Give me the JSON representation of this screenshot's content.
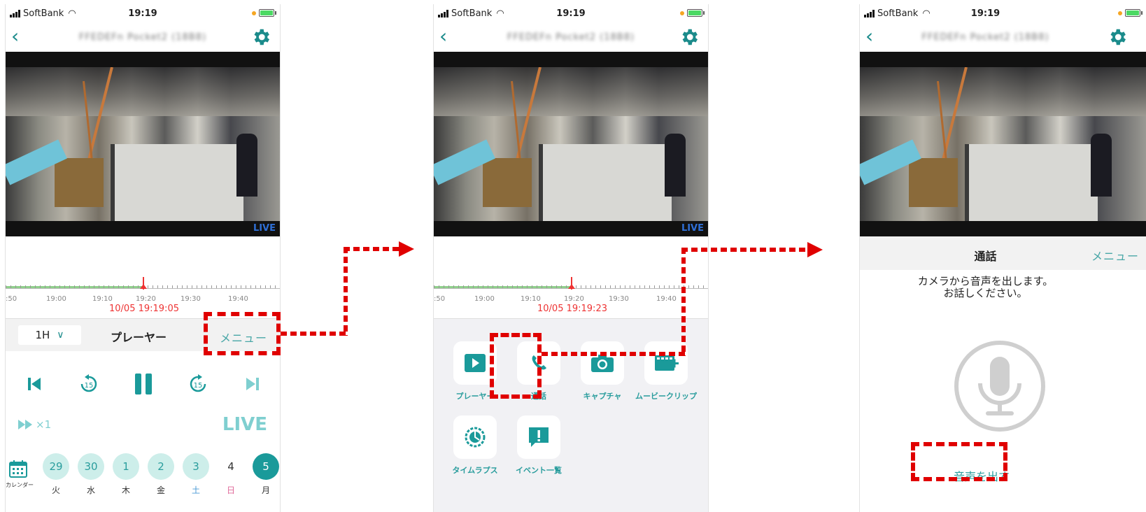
{
  "status_bar": {
    "carrier": "SoftBank",
    "time": "19:19"
  },
  "nav": {
    "title": "FFEDEFn Pocket2 (18B8)"
  },
  "video": {
    "live_badge": "LIVE"
  },
  "screen1": {
    "timeline": {
      "labels": [
        ":50",
        "19:00",
        "19:10",
        "19:20",
        "19:30",
        "19:40"
      ],
      "current_datetime": "10/05 19:19:05"
    },
    "controlbar": {
      "range": "1H",
      "title": "プレーヤー",
      "menu": "メニュー"
    },
    "speed": "×1",
    "live_button": "LIVE",
    "calendar_label": "カレンダー",
    "days": [
      {
        "num": "29",
        "week": "火"
      },
      {
        "num": "30",
        "week": "水"
      },
      {
        "num": "1",
        "week": "木"
      },
      {
        "num": "2",
        "week": "金"
      },
      {
        "num": "3",
        "week": "土"
      },
      {
        "num": "4",
        "week": "日"
      },
      {
        "num": "5",
        "week": "月"
      }
    ]
  },
  "screen2": {
    "timeline": {
      "labels": [
        ":50",
        "19:00",
        "19:10",
        "19:20",
        "19:30",
        "19:40"
      ],
      "current_datetime": "10/05 19:19:23"
    },
    "menu_items": [
      {
        "label": "プレーヤー",
        "icon": "play-icon"
      },
      {
        "label": "通話",
        "icon": "phone-icon"
      },
      {
        "label": "キャプチャ",
        "icon": "camera-icon"
      },
      {
        "label": "ムービークリップ",
        "icon": "movie-clip-icon"
      },
      {
        "label": "タイムラプス",
        "icon": "timelapse-icon"
      },
      {
        "label": "イベント一覧",
        "icon": "event-list-icon"
      }
    ]
  },
  "screen3": {
    "header_title": "通話",
    "menu": "メニュー",
    "message_line1": "カメラから音声を出します。",
    "message_line2": "お話しください。",
    "speak_button": "音声を出す"
  },
  "colors": {
    "teal": "#1a9a9a",
    "light_teal": "#cdeeea",
    "annotation_red": "#e00000",
    "marker_red": "#e33333"
  }
}
